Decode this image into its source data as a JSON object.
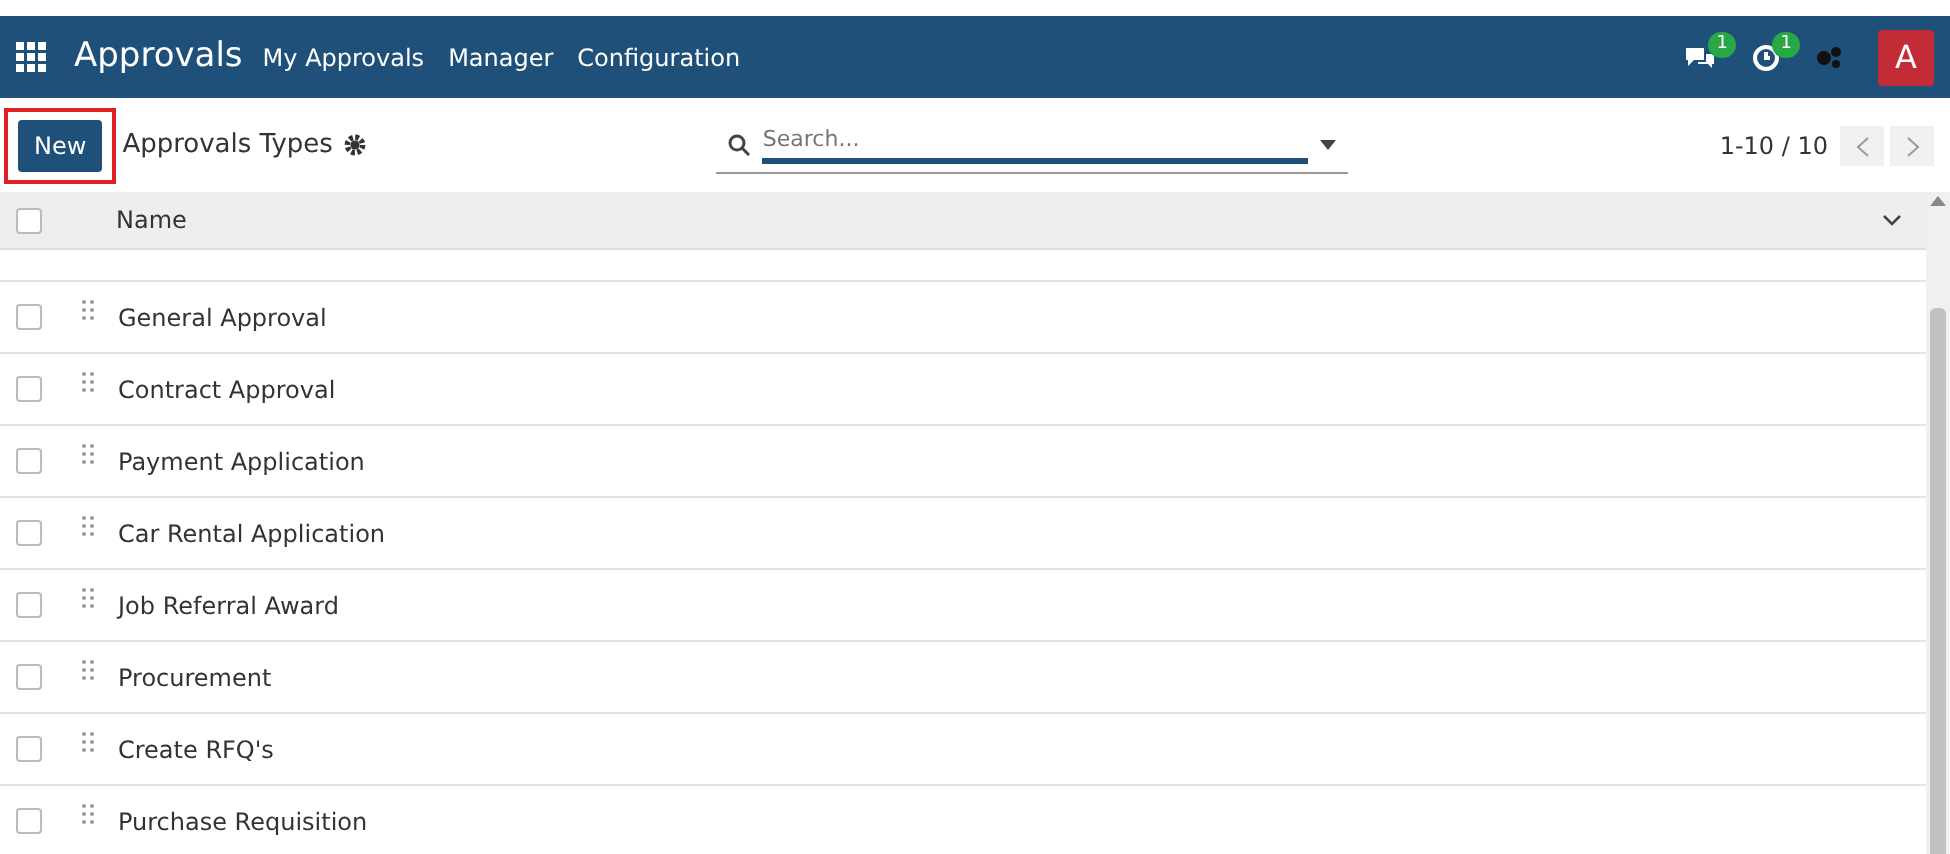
{
  "navbar": {
    "app_title": "Approvals",
    "menu": [
      "My Approvals",
      "Manager",
      "Configuration"
    ],
    "message_count": "1",
    "activity_count": "1",
    "avatar": "A"
  },
  "control_panel": {
    "new_button": "New",
    "breadcrumb": "Approvals Types",
    "search": {
      "placeholder": "Search..."
    },
    "pager": "1-10 / 10"
  },
  "table": {
    "columns": [
      "Name"
    ],
    "all_checked": false,
    "rows": [
      {
        "name": "General Approval",
        "checked": false
      },
      {
        "name": "Contract Approval",
        "checked": false
      },
      {
        "name": "Payment Application",
        "checked": false
      },
      {
        "name": "Car Rental Application",
        "checked": false
      },
      {
        "name": "Job Referral Award",
        "checked": false
      },
      {
        "name": "Procurement",
        "checked": false
      },
      {
        "name": "Create RFQ's",
        "checked": false
      },
      {
        "name": "Purchase Requisition",
        "checked": false
      }
    ]
  }
}
